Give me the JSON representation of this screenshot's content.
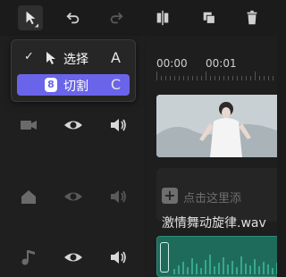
{
  "toolbar": {
    "buttons": [
      {
        "name": "select-tool",
        "icon": "cursor-icon",
        "active": true
      },
      {
        "name": "undo",
        "icon": "undo-icon"
      },
      {
        "name": "redo",
        "icon": "redo-icon"
      },
      {
        "name": "split",
        "icon": "split-icon"
      },
      {
        "name": "crop",
        "icon": "layers-icon"
      },
      {
        "name": "delete",
        "icon": "trash-icon"
      }
    ]
  },
  "menu": {
    "items": [
      {
        "label": "选择",
        "shortcut": "A",
        "checked": true,
        "icon": "cursor-icon"
      },
      {
        "label": "切割",
        "shortcut": "C",
        "selected": true,
        "icon": "cut-badge-icon",
        "badge": "8"
      }
    ]
  },
  "tracks": [
    {
      "type": "video",
      "icons": [
        "video-camera-icon",
        "eye-icon",
        "speaker-icon"
      ]
    },
    {
      "type": "cover",
      "icons": [
        "home-icon",
        "eye-icon",
        "speaker-icon"
      ]
    },
    {
      "type": "audio",
      "icons": [
        "music-note-icon",
        "eye-icon",
        "speaker-icon"
      ]
    }
  ],
  "timeline": {
    "ruler_labels": [
      "00:00",
      "00:01"
    ],
    "add_text": "点击这里添",
    "audio_name": "激情舞动旋律.wav"
  },
  "colors": {
    "accent": "#6a64ea",
    "audio": "#1f6b5b"
  }
}
